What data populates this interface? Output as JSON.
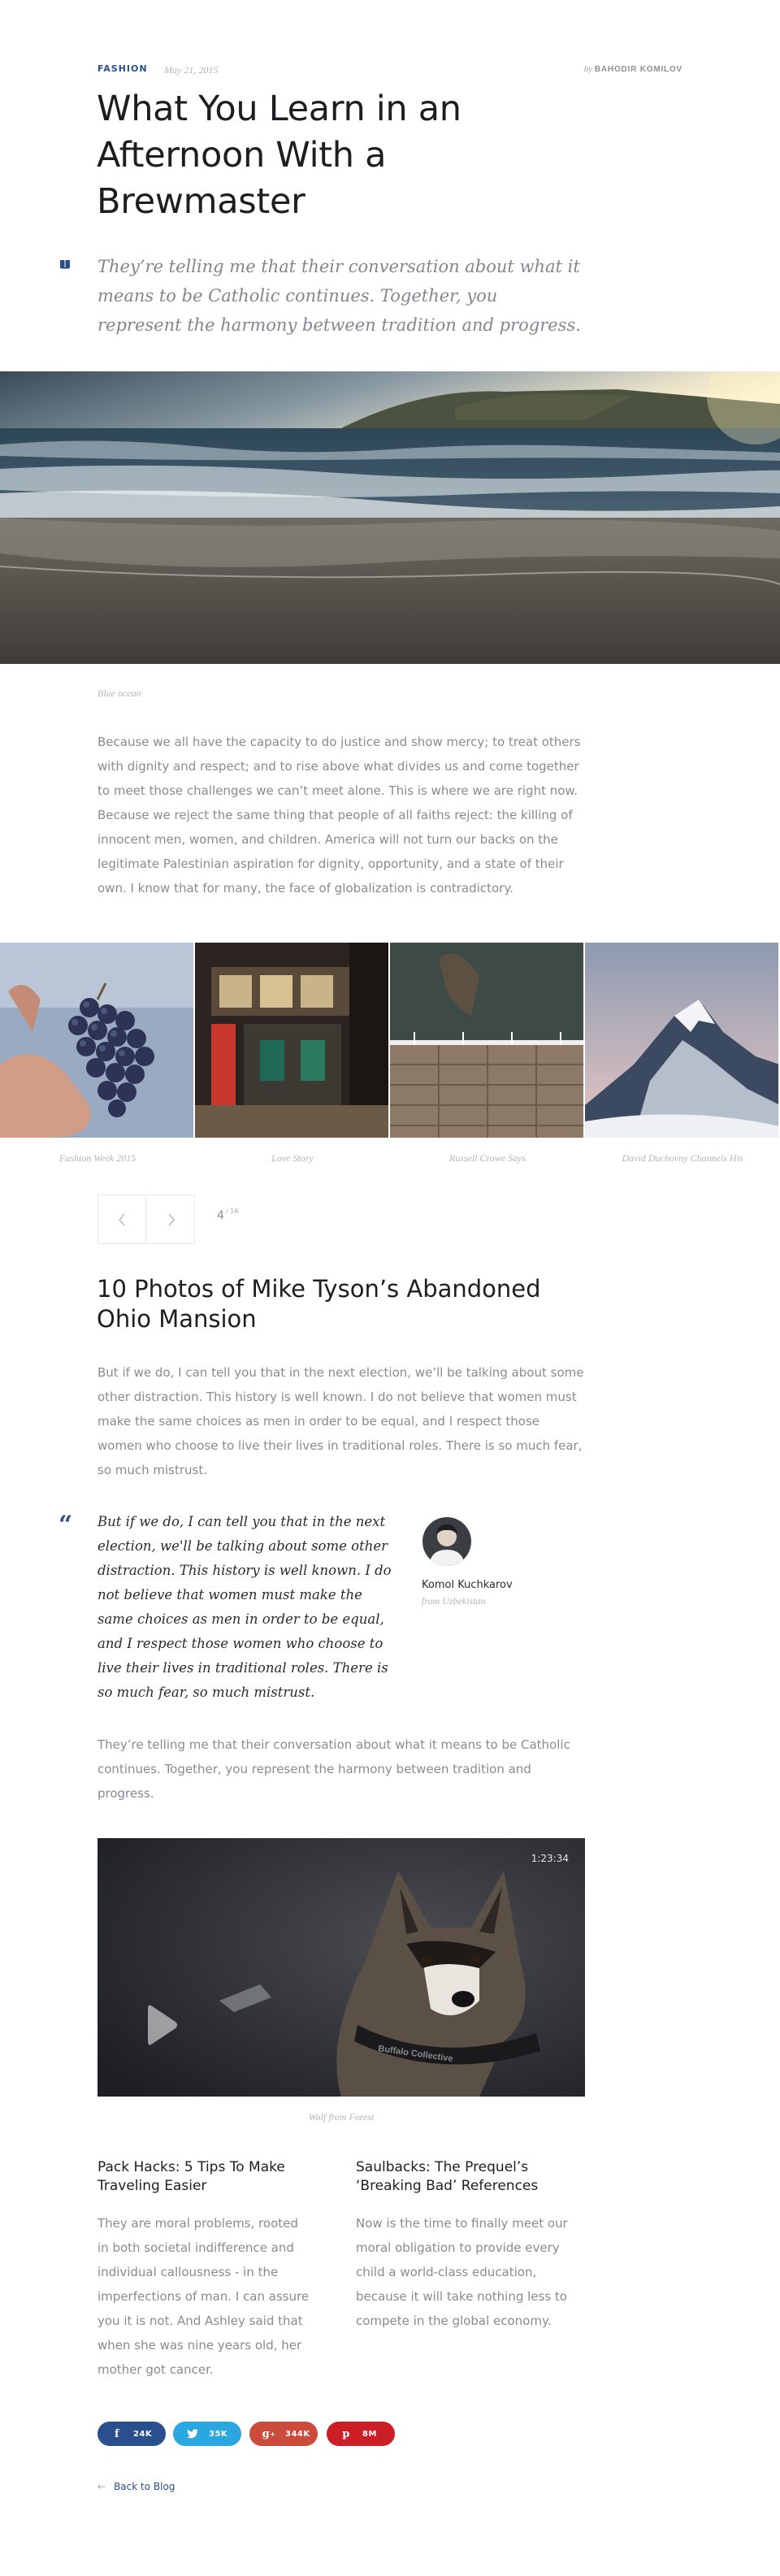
{
  "header": {
    "category": "FASHION",
    "date": "May 21, 2015",
    "by": "by",
    "author": "BAHODIR KOMILOV"
  },
  "article": {
    "title": "What You Learn in an Afternoon With a Brewmaster",
    "lead": "They’re telling me that their conversation about what it means to be Catholic continues. Together, you represent the harmony between tradition and progress.",
    "hero_caption": "Blue ocean",
    "paragraph_1": "Because we all have the capacity to do justice and show mercy; to treat others with dignity and respect; and to rise above what divides us and come together to meet those challenges we can’t meet alone. This is where we are right now. Because we reject the same thing that people of all faiths reject: the killing of innocent men, women, and children. America will not turn our backs on the legitimate Palestinian aspiration for dignity, opportunity, and a state of their own. I know that for many, the face of globalization is contradictory."
  },
  "gallery": {
    "captions": [
      "Fashion Week 2015",
      "Love Story",
      "Russell Crowe Says",
      "David Duchovny Channels His"
    ],
    "current": "4",
    "total": "16"
  },
  "section": {
    "heading": "10 Photos of Mike Tyson’s Abandoned Ohio Mansion",
    "paragraph_2": "But if we do, I can tell you that in the next election, we’ll be talking about some other distraction. This history is well known. I do not believe that women must make the same choices as men in order to be equal, and I respect those women who choose to live their lives in traditional roles. There is so much fear, so much mistrust.",
    "quote": "But if we do, I can tell you that in the next election, we'll be talking about some other distraction. This history is well known. I do not believe that women must make the same choices as men in order to be equal, and I respect those women who choose to live their lives in traditional roles. There is so much fear, so much mistrust.",
    "quote_author": "Komol Kuchkarov",
    "quote_from": "from Uzbekistan",
    "paragraph_3": "They’re telling me that their conversation about what it means to be Catholic continues. Together, you represent the harmony between tradition and progress."
  },
  "video": {
    "duration": "1:23:34",
    "caption": "Wolf from Forest",
    "collar_text": "Buffalo Collective"
  },
  "related": [
    {
      "title": "Pack Hacks: 5 Tips To Make Traveling Easier",
      "text": "They are moral problems, rooted in both societal indifference and individual callousness - in the imperfections of man. I can assure you it is not. And Ashley said that when she was nine years old, her mother got cancer."
    },
    {
      "title": "Saulbacks: The Prequel’s ‘Breaking Bad’ References",
      "text": "Now is the time to finally meet our moral obligation to provide every child a world-class education, because it will take nothing less to compete in the global economy."
    }
  ],
  "share": {
    "facebook": "24K",
    "twitter": "35K",
    "google": "344K",
    "pinterest": "8M",
    "colors": {
      "facebook": "#2a4f8e",
      "twitter": "#2aa6e0",
      "google": "#cd4b3a",
      "pinterest": "#cb1f25"
    }
  },
  "footer": {
    "back_label": "Back to Blog"
  }
}
